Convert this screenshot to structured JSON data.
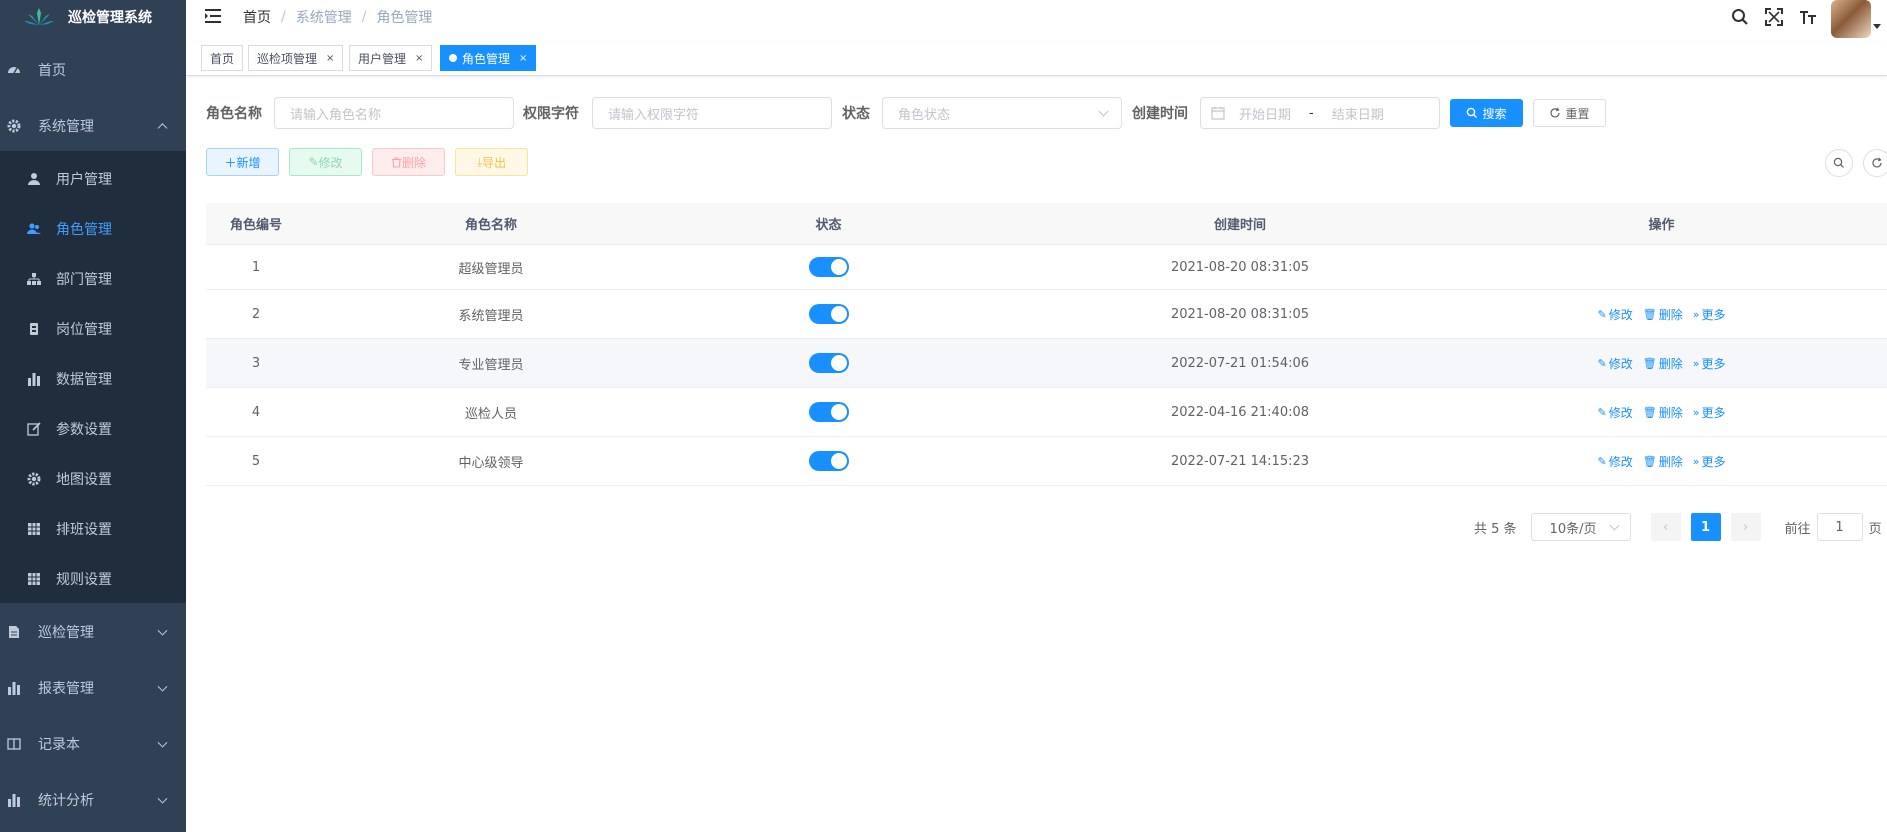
{
  "app": {
    "title": "巡检管理系统",
    "accent": "#1890ff"
  },
  "sidebar": {
    "top_items": [
      {
        "label": "首页",
        "icon": "dashboard-icon"
      },
      {
        "label": "系统管理",
        "icon": "gear-icon",
        "expanded": true
      }
    ],
    "sub_items": [
      {
        "label": "用户管理",
        "icon": "user-icon"
      },
      {
        "label": "角色管理",
        "icon": "peoples-icon",
        "active": true
      },
      {
        "label": "部门管理",
        "icon": "tree-icon"
      },
      {
        "label": "岗位管理",
        "icon": "post-icon"
      },
      {
        "label": "数据管理",
        "icon": "bar-chart-icon"
      },
      {
        "label": "参数设置",
        "icon": "edit-icon"
      },
      {
        "label": "地图设置",
        "icon": "gear-icon"
      },
      {
        "label": "排班设置",
        "icon": "grid-icon"
      },
      {
        "label": "规则设置",
        "icon": "grid-icon"
      }
    ],
    "bottom_items": [
      {
        "label": "巡检管理",
        "icon": "document-icon"
      },
      {
        "label": "报表管理",
        "icon": "bar-chart-icon"
      },
      {
        "label": "记录本",
        "icon": "book-icon"
      },
      {
        "label": "统计分析",
        "icon": "bar-chart-icon"
      }
    ]
  },
  "navbar": {
    "breadcrumb": [
      "首页",
      "系统管理",
      "角色管理"
    ]
  },
  "tags": [
    {
      "label": "首页",
      "closable": false
    },
    {
      "label": "巡检项管理",
      "closable": true
    },
    {
      "label": "用户管理",
      "closable": true
    },
    {
      "label": "角色管理",
      "closable": true,
      "active": true
    }
  ],
  "search": {
    "role_name_label": "角色名称",
    "role_name_placeholder": "请输入角色名称",
    "role_key_label": "权限字符",
    "role_key_placeholder": "请输入权限字符",
    "status_label": "状态",
    "status_placeholder": "角色状态",
    "created_label": "创建时间",
    "start_placeholder": "开始日期",
    "range_sep": "-",
    "end_placeholder": "结束日期",
    "search_btn": "搜索",
    "reset_btn": "重置"
  },
  "toolbar": {
    "add": "新增",
    "edit": "修改",
    "delete": "删除",
    "export": "导出"
  },
  "table": {
    "columns": [
      "角色编号",
      "角色名称",
      "状态",
      "创建时间",
      "操作"
    ],
    "rows": [
      {
        "id": "1",
        "name": "超级管理员",
        "enabled": true,
        "created": "2021-08-20 08:31:05",
        "actions": false
      },
      {
        "id": "2",
        "name": "系统管理员",
        "enabled": true,
        "created": "2021-08-20 08:31:05",
        "actions": true
      },
      {
        "id": "3",
        "name": "专业管理员",
        "enabled": true,
        "created": "2022-07-21 01:54:06",
        "actions": true
      },
      {
        "id": "4",
        "name": "巡检人员",
        "enabled": true,
        "created": "2022-04-16 21:40:08",
        "actions": true
      },
      {
        "id": "5",
        "name": "中心级领导",
        "enabled": true,
        "created": "2022-07-21 14:15:23",
        "actions": true
      }
    ],
    "action_labels": {
      "edit": "修改",
      "delete": "删除",
      "more": "更多"
    }
  },
  "pagination": {
    "total": "共 5 条",
    "page_size": "10条/页",
    "current": "1",
    "goto_label": "前往",
    "goto_value": "1",
    "page_suffix": "页"
  }
}
